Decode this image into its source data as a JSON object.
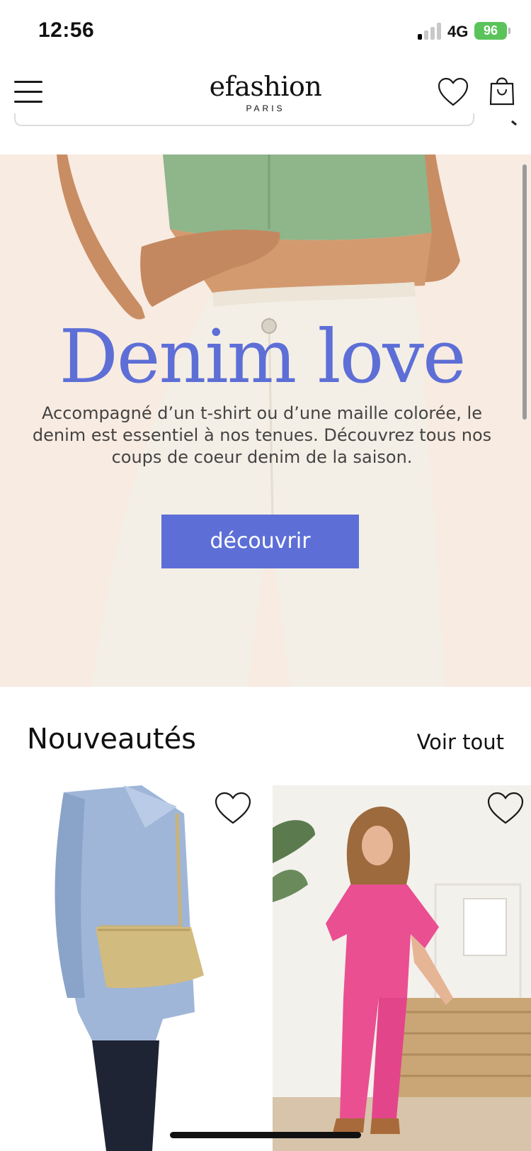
{
  "status_bar": {
    "time": "12:56",
    "network": "4G",
    "battery": "96"
  },
  "header": {
    "brand_name": "efashion",
    "brand_sub": "PARIS",
    "icons": [
      "menu-icon",
      "heart-icon",
      "shopping-bag-icon"
    ]
  },
  "hero": {
    "title": "Denim love",
    "text": "Accompagné d’un t-shirt ou d’une maille colorée, le denim est essentiel à nos tenues. Découvrez tous nos coups de coeur denim de la saison.",
    "cta_label": "découvrir",
    "accent_color": "#5d6fd6",
    "background_color": "#f8ebe1"
  },
  "new_arrivals": {
    "title": "Nouveautés",
    "see_all_label": "Voir tout",
    "products": [
      {
        "image": "gold-shoulder-bag-on-blue-blazer",
        "favorite_icon": "heart-outline-icon"
      },
      {
        "image": "pink-jumpsuit-on-model",
        "favorite_icon": "heart-outline-icon"
      }
    ]
  }
}
